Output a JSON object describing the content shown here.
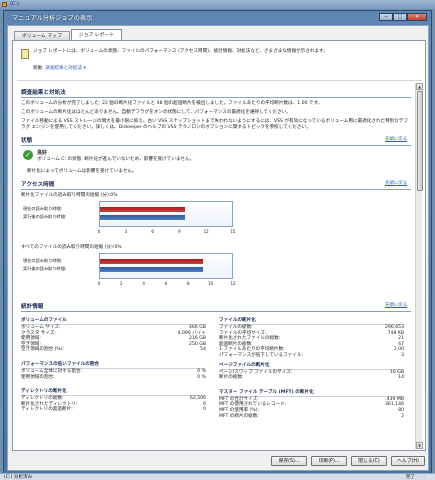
{
  "outer": {
    "title": "(C:)"
  },
  "dialog": {
    "title": "マニュアル分析ジョブの表示",
    "minimize": "─",
    "maximize": "□",
    "close": "✕"
  },
  "tabs": [
    {
      "label": "ボリューム マップ"
    },
    {
      "label": "ジョブ レポート"
    }
  ],
  "header": {
    "description": "ジョブ レポートには、ボリュームの状態、ファイルのパフォーマンス (アクセス時間)、統計情報、対処法など、さまざまな情報が示されます。",
    "move_label": "移動:",
    "move_target": "調査結果と対処法",
    "move_arrow": "▾"
  },
  "sections": {
    "summary": {
      "title": "調査結果と対処法",
      "p1": "このボリュームの分析が完了しました: 22 個の断片化ファイルと 48 個の超過断片を検出しました。ファイルあたりの平均断片数は、1.00 です。",
      "p2": "このボリュームの断片化はほとんどありません。自動デフラグをオンの状態にして、パフォーマンスの最適化を維持してください。",
      "p3": "ファイル移動による VSS ストレージの増大を最小限に抑え、古い VSS スナップショットまで失われないようにするには、VSS が有効になっているボリューム用に最適化された特別なデフラグ エンジンを使用してください。詳しくは、Diskeeper のヘルプの VSS テクノロジのオプションに関するトピックを参照してください。"
    },
    "status": {
      "title": "状態",
      "back": "先頭に戻る",
      "ok_label": "良好",
      "line1": "ボリューム C: の状態: 断片化が進んでいないため、影響を受けていません。",
      "line2": "断片化によってボリュームは影響を受けていません。"
    },
    "access": {
      "title": "アクセス時間",
      "back": "先頭に戻る",
      "chart1_title": "断片化ファイルの読み取り時間の短縮 (分):0%",
      "chart2_title": "すべてのファイルの読み取り時間の短縮 (分):0%",
      "row_current": "現在の読み取り時間:",
      "row_actual": "実行後の読み取り時間:"
    },
    "stats": {
      "title": "統計情報",
      "back": "先頭に戻る",
      "volume_files": {
        "heading": "ボリュームのファイル",
        "rows": [
          {
            "k": "ボリューム サイズ:",
            "v": "466 GB"
          },
          {
            "k": "クラスタ サイズ:",
            "v": "4,096 バイト"
          },
          {
            "k": "使用領域:",
            "v": "216 GB"
          },
          {
            "k": "空き領域:",
            "v": "250 GB"
          },
          {
            "k": "空き領域の割合 (%):",
            "v": "54"
          }
        ]
      },
      "file_frag": {
        "heading": "ファイルの断片化",
        "rows": [
          {
            "k": "ファイルの総数:",
            "v": "296,653"
          },
          {
            "k": "ファイルの平均サイズ:",
            "v": "748 KB"
          },
          {
            "k": "断片化されたファイルの総数:",
            "v": "21"
          },
          {
            "k": "超過断片の総数:",
            "v": "47"
          },
          {
            "k": "1 ファイルあたりの平均断片数:",
            "v": "1.00"
          },
          {
            "k": "パフォーマンスが低下しているファイル:",
            "v": "3"
          }
        ]
      },
      "perf_ratio": {
        "heading": "パフォーマンスの低いファイルの割合",
        "rows": [
          {
            "k": "ボリューム全体に対する割合:",
            "v": "0 %"
          },
          {
            "k": "使用領域の割合:",
            "v": "0 %"
          }
        ]
      },
      "page_frag": {
        "heading": "ページファイルの断片化",
        "rows": [
          {
            "k": "ページ/スワップ ファイルのサイズ:",
            "v": "16 GB"
          },
          {
            "k": "断片の総数:",
            "v": "14"
          }
        ]
      },
      "dir_frag": {
        "heading": "ディレクトリの断片化",
        "rows": [
          {
            "k": "ディレクトリの総数:",
            "v": "62,506"
          },
          {
            "k": "断片化されたディレクトリ:",
            "v": "6"
          },
          {
            "k": "ディレクトリの超過断片:",
            "v": "0"
          }
        ]
      },
      "mft_frag": {
        "heading": "マスター ファイル テーブル (MFT) の断片化",
        "rows": [
          {
            "k": "MFT の合計サイズ:",
            "v": "439 MB"
          },
          {
            "k": "MFT の使用されているレコード:",
            "v": "361,146"
          },
          {
            "k": "MFT の使用率 (%):",
            "v": "80"
          },
          {
            "k": "MFT の断片の総数:",
            "v": "2"
          }
        ]
      }
    }
  },
  "chart_data": [
    {
      "type": "bar",
      "title": "断片化ファイルの読み取り時間の短縮 (分):0%",
      "categories": [
        "現在の読み取り時間:",
        "実行後の読み取り時間:"
      ],
      "values": [
        9.5,
        9.5
      ],
      "xlim": [
        0,
        15
      ],
      "ticks": [
        "0",
        "3",
        "6",
        "9",
        "12",
        "15"
      ]
    },
    {
      "type": "bar",
      "title": "すべてのファイルの読み取り時間の短縮 (分):0%",
      "categories": [
        "現在の読み取り時間:",
        "実行後の読み取り時間:"
      ],
      "values": [
        9.2,
        9.2
      ],
      "xlim": [
        0,
        12
      ],
      "ticks": [
        "0",
        "2",
        "4",
        "6",
        "8",
        "10",
        "12"
      ]
    }
  ],
  "colors": {
    "current": "#b01818",
    "actual": "#2d5ea8"
  },
  "buttons": {
    "save": "保存(S)...",
    "print": "印刷(P)...",
    "close": "閉じる(C)",
    "help": "ヘルプ(H)"
  },
  "statusbar": {
    "left": "(C:) 分析済み",
    "right": "完了"
  }
}
